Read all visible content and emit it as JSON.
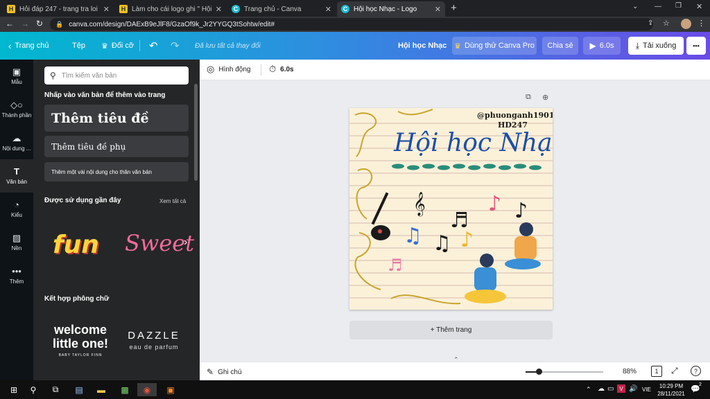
{
  "browser": {
    "tabs": [
      {
        "title": "Hỏi đáp 247 - trang tra loi",
        "icon": "h247-favicon"
      },
      {
        "title": "Làm cho cái logo ghi \" Hội học N",
        "icon": "h247-favicon"
      },
      {
        "title": "Trang chủ - Canva",
        "icon": "canva-favicon"
      },
      {
        "title": "Hội học Nhạc - Logo",
        "icon": "canva-favicon"
      }
    ],
    "new_tab": "+",
    "url": "canva.com/design/DAExB9eJlF8/GzaOf9k_Jr2YYGQ3tSohtw/edit#"
  },
  "toolbar": {
    "home": "Trang chủ",
    "file": "Tệp",
    "resize": "Đổi cỡ",
    "saved_status": "Đã lưu tất cả thay đổi",
    "design_title": "Hội học Nhạc",
    "try_pro": "Dùng thử Canva Pro",
    "share": "Chia sẻ",
    "play": "6.0s",
    "download": "Tải xuống",
    "more": "•••"
  },
  "rail": [
    {
      "label": "Mẫu",
      "icon": "template-icon"
    },
    {
      "label": "Thành phần",
      "icon": "elements-icon"
    },
    {
      "label": "Nội dung ...",
      "icon": "upload-icon"
    },
    {
      "label": "Văn bản",
      "icon": "text-icon"
    },
    {
      "label": "Kiểu",
      "icon": "palette-icon"
    },
    {
      "label": "Nền",
      "icon": "background-icon"
    },
    {
      "label": "Thêm",
      "icon": "more-icon"
    }
  ],
  "panel": {
    "search_placeholder": "Tìm kiếm văn bản",
    "instruction": "Nhấp vào văn bản để thêm vào trang",
    "add_heading": "Thêm tiêu đề",
    "add_subheading": "Thêm tiêu đề phụ",
    "add_body": "Thêm một vài nội dung cho thân văn bản",
    "recent_title": "Được sử dụng gần đây",
    "see_all": "Xem tất cả",
    "recent_fonts": [
      "fun",
      "Sweet"
    ],
    "combo_title": "Kết hợp phông chữ",
    "combo_1": {
      "line1": "welcome",
      "line2": "little one!",
      "line3": "BABY TAYLOR FINN"
    },
    "combo_2": {
      "line1": "DAZZLE",
      "line2": "eau de parfum"
    }
  },
  "workhead": {
    "animate": "Hình động",
    "duration": "6.0s"
  },
  "design": {
    "credit_line1": "@phuonganh1901",
    "credit_line2": "HD247",
    "title": "Hội học Nhạc"
  },
  "add_page": "+ Thêm trang",
  "bottombar": {
    "notes": "Ghi chú",
    "zoom": "88%",
    "page_count": "1"
  },
  "taskbar": {
    "lang": "VIE",
    "time": "10:29 PM",
    "date": "28/11/2021",
    "notif": "2"
  },
  "colors": {
    "toolbar_start": "#00b8cf",
    "toolbar_end": "#6a4be6",
    "panel_bg": "#252627",
    "design_title": "#1d4fa8"
  }
}
